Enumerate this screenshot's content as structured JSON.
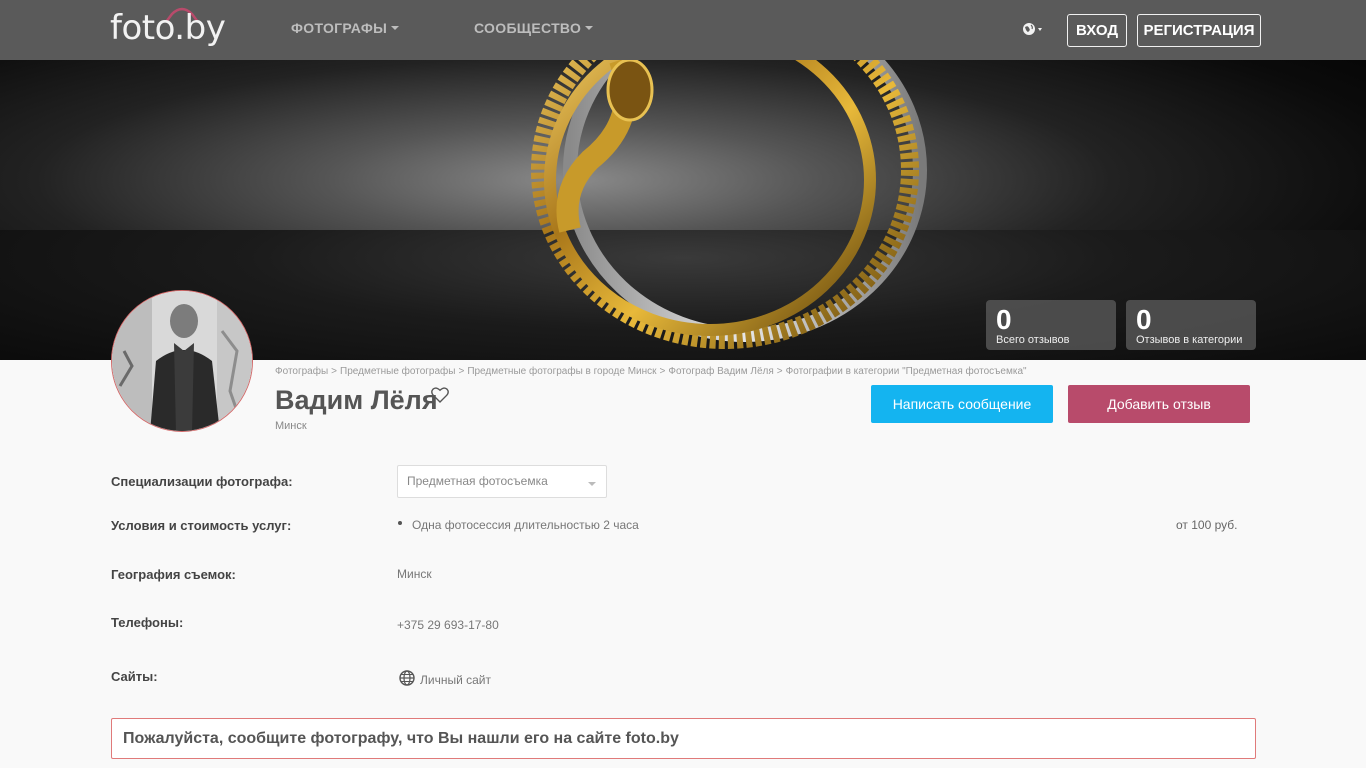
{
  "header": {
    "logo": "foto.by",
    "nav": [
      {
        "label": "ФОТОГРАФЫ"
      },
      {
        "label": "СООБЩЕСТВО"
      }
    ],
    "login_label": "ВХОД",
    "register_label": "РЕГИСТРАЦИЯ"
  },
  "stats": [
    {
      "value": "0",
      "label": "Всего отзывов"
    },
    {
      "value": "0",
      "label": "Отзывов в категории"
    }
  ],
  "breadcrumb": [
    "Фотографы",
    "Предметные фотографы",
    "Предметные фотографы в городе Минск",
    "Фотограф Вадим Лёля",
    "Фотографии в категории \"Предметная фотосъемка\""
  ],
  "profile": {
    "name": "Вадим Лёля",
    "city": "Минск",
    "message_button": "Написать сообщение",
    "review_button": "Добавить отзыв"
  },
  "details": {
    "specializations_label": "Специализации фотографа:",
    "specialization_selected": "Предметная фотосъемка",
    "services_label": "Условия и стоимость услуг:",
    "service_item": "Одна фотосессия длительностью 2 часа",
    "service_price": "от 100 руб.",
    "geography_label": "География съемок:",
    "geography_value": "Минск",
    "phones_label": "Телефоны:",
    "phone_value": "+375 29 693-17-80",
    "sites_label": "Сайты:",
    "site_value": "Личный сайт"
  },
  "notice": "Пожалуйста, сообщите фотографу, что Вы нашли его на сайте foto.by",
  "colors": {
    "header_bg": "#5a5a5a",
    "message_button": "#14b4f0",
    "review_button": "#b84b6b",
    "notice_border": "#e07a7a"
  }
}
